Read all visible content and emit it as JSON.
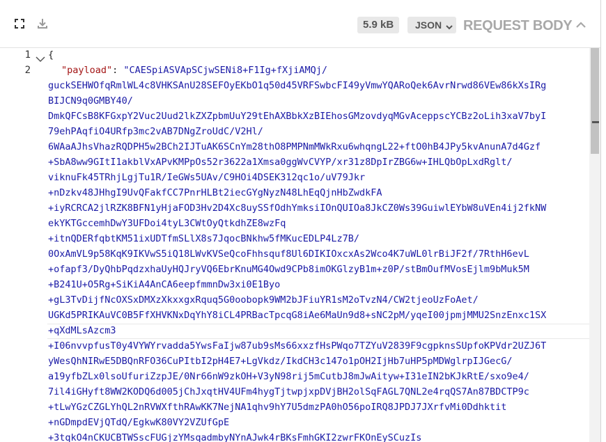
{
  "toolbar": {
    "expand_icon": "expand-icon",
    "download_icon": "download-icon",
    "size": "5.9 kB",
    "format": "JSON",
    "title": "REQUEST BODY",
    "collapse_icon": "chevron-up-icon"
  },
  "editor": {
    "line_numbers": [
      "1",
      "2"
    ],
    "open_brace": "{",
    "key": "\"payload\"",
    "colon": ": ",
    "lines": [
      "\"CAESpiASVApSCjwSENi8+F1Ig+fXjiAMQj/",
      "guckSEHWOfqRmlWL4c8VHKSAnU28SEFOyEKbO1q50d45VRFSwbcFI49yVmwYQARoQek6AvrNrwd86VEw86kXsIRg",
      "BIJCN9q0GMBY40/",
      "DmkQFCsB8KFGxpY2Vuc2Uud2lkZXZpbmUuY29tEhAXBbkXzBIEhosGMzovdyqMGvAceppscYCBz2oLih3xaV7byI",
      "79ehPAqfiO4URfp3mc2vAB7DNgZroUdC/V2Hl/",
      "6WAaAJhsVhazRQDPH5w2BCh2IJTuAK6SCnYm28thO8PMPNmMWkRxu6whqngL22+ftO0hB4JPy5kvAnunA7d4Gzf",
      "+SbA8ww9GItI1akblVxAPvKMPpOs52r3622a1Xmsa0ggWvCVYP/xr31z8DpIrZBG6w+IHLQbOpLxdRglt/",
      "viknuFk45TRhjLgjTu1R/IeGWs5UAv/C9HOi4DSEK312qc1o/uV79Jkr",
      "+nDzkv48JHhgI9UvQFakfCC7PnrHLBt2iecGYgNyzN48LhEqQjnHbZwdkFA",
      "+iyRCRCA2jlRZK8BFN1yHjaFOD3Hv2D4Xc8uySSfOdhYmksiIOnQUIOa8JkCZ0Ws39GuiwlEYbW8uVEn4ij2fkNW",
      "ekYKTGccemhDwY3UFDoi4tyL3CWtOyQtkdhZE8wzFq",
      "+itnQDERfqbtKM51ixUDTfmSLlX8s7JqocBNkhw5fMKucEDLP4Lz7B/",
      "0OxAmVL9p58KqK9IKVwS5iQ18LWvKVSeQcoFhhsquf8Ul6DIKIOxcxAs2Wco4K7uWL0lrBiJF2f/7RthH6evL",
      "+ofapf3/DyQhbPqdzxhaUyHQJryVQ6EbrKnuMG4Owd9CPb8imOKGlzyB1m+z0P/stBmOufMVosEjlm9bMuk5M",
      "+B241U+O5Rg+SiKiA4AnCA6eepfmmnDw3xi0E1Byo",
      "+gL3TvDijfNcOXSxDMXzXkxxgxRquq5G0oobopk9WM2bJFiuYR1sM2oTvzN4/CW2tjeoUzFoAet/",
      "UGKd5PRIKAuVC0B5FfXHVKNxDqYhY8iCL4PRBacTpcqG8iAe6MaUn9d8+sNC2pM/yqeI00jpmjMMU2SnzEnxc1SX",
      "+qXdMLsAzcm3",
      "+I06nvvpfusT0y4VYWYrvadda5YwsFaIjw87ub9sMs66xxzfHsPWqo7TZYuV2839F9cgpknsSUpfoKPVdr2UZJ6T",
      "yWesQhNIRwE5DBQnRFO36CuPItbI2pH4E7+LgVkdz/IkdCH3c147o1pOH2IjHb7uHP5pMDWglrpIJGecG/",
      "a19yfbZLx0lsoUfuriZzpJE/0Nr66nW9zkOH+V3yN98rij5mCutbJ8mJwAityw+I31eIN2bKJkRtE/sxo9e4/",
      "7il4iGHyft8WW2KODQ6d005jChJxqtHV4UFm4hygTjtwpjxpDVjBH2olSqFAGL7QNL2e4rqQS7An87BDCTP9c",
      "+tLwYGzCZGLYhQL2nRVWXfthRAwKK7NejNA1qhv9hY7U5dmzPA0hO56poIRQ8JPDJ7JXrfvMi0Ddhktit",
      "+nGDmpdEVjQTdQ/EgkwK80VY2VZUfGpE",
      "+3tqkO4nCKUCBTWSscFUGjzYMsqadmbyNYnAJwk4rBKsFmhGKI2zwrFKOnEySCuzIs"
    ]
  }
}
